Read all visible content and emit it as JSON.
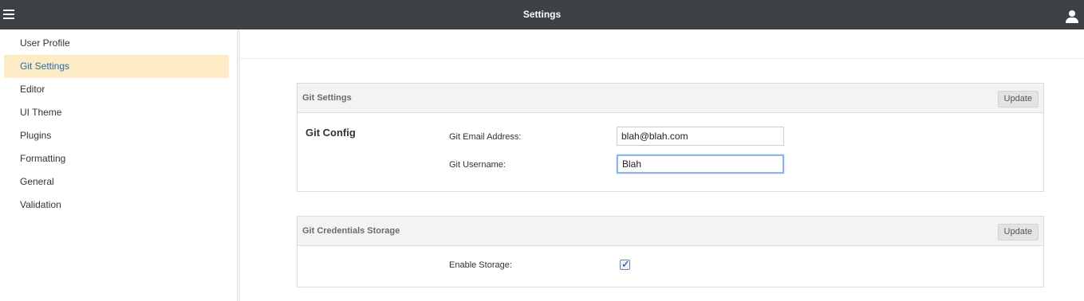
{
  "header": {
    "title": "Settings",
    "menu_icon": "hamburger-icon",
    "user_icon": "user-icon"
  },
  "sidebar": {
    "items": [
      {
        "label": "User Profile"
      },
      {
        "label": "Git Settings",
        "active": true
      },
      {
        "label": "Editor"
      },
      {
        "label": "UI Theme"
      },
      {
        "label": "Plugins"
      },
      {
        "label": "Formatting"
      },
      {
        "label": "General"
      },
      {
        "label": "Validation"
      }
    ]
  },
  "git_settings_panel": {
    "title": "Git Settings",
    "update_label": "Update",
    "section_title": "Git Config",
    "email_label": "Git Email Address:",
    "email_value": "blah@blah.com",
    "username_label": "Git Username:",
    "username_value": "Blah"
  },
  "credentials_panel": {
    "title": "Git Credentials Storage",
    "update_label": "Update",
    "enable_storage_label": "Enable Storage:",
    "enable_storage_checked": true
  },
  "colors": {
    "topbar": "#3d4245",
    "active_item_bg": "#fdebc6",
    "active_item_text": "#1f6fa6"
  }
}
